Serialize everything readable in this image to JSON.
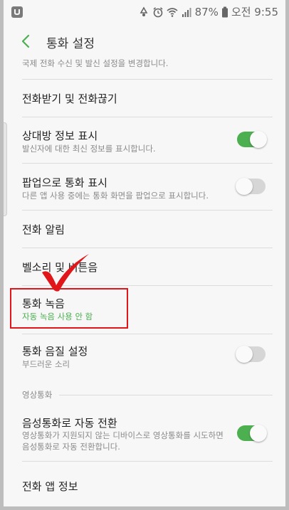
{
  "status_bar": {
    "battery_percent": "87%",
    "time": "오전 9:55"
  },
  "header": {
    "title": "통화 설정"
  },
  "partial_item": {
    "subtitle": "국제 전화 수신 및 발신 설정을 변경합니다."
  },
  "items": [
    {
      "title": "전화받기 및 전화끊기"
    },
    {
      "title": "상대방 정보 표시",
      "subtitle": "발신자에 대한 최신 정보를 표시합니다.",
      "toggle": "on"
    },
    {
      "title": "팝업으로 통화 표시",
      "subtitle": "다른 앱 사용 중에는 통화 화면을 팝업으로 표시합니다.",
      "toggle": "off"
    },
    {
      "title": "전화 알림"
    },
    {
      "title": "벨소리 및 버튼음"
    },
    {
      "title": "통화 녹음",
      "subtitle": "자동 녹음 사용 안 함"
    },
    {
      "title": "통화 음질 설정",
      "subtitle": "부드러운 소리",
      "toggle": "off"
    }
  ],
  "section": {
    "title": "영상통화"
  },
  "video_items": [
    {
      "title": "음성통화로 자동 전환",
      "subtitle_line1": "영상통화가 지원되지 않는 디바이스로 영상통화를 시도하면",
      "subtitle_line2": "음성통화로 자동 전환합니다.",
      "toggle": "on"
    },
    {
      "title": "전화 앱 정보"
    }
  ],
  "colors": {
    "accent": "#4caf50",
    "annotation": "#e0161b"
  }
}
